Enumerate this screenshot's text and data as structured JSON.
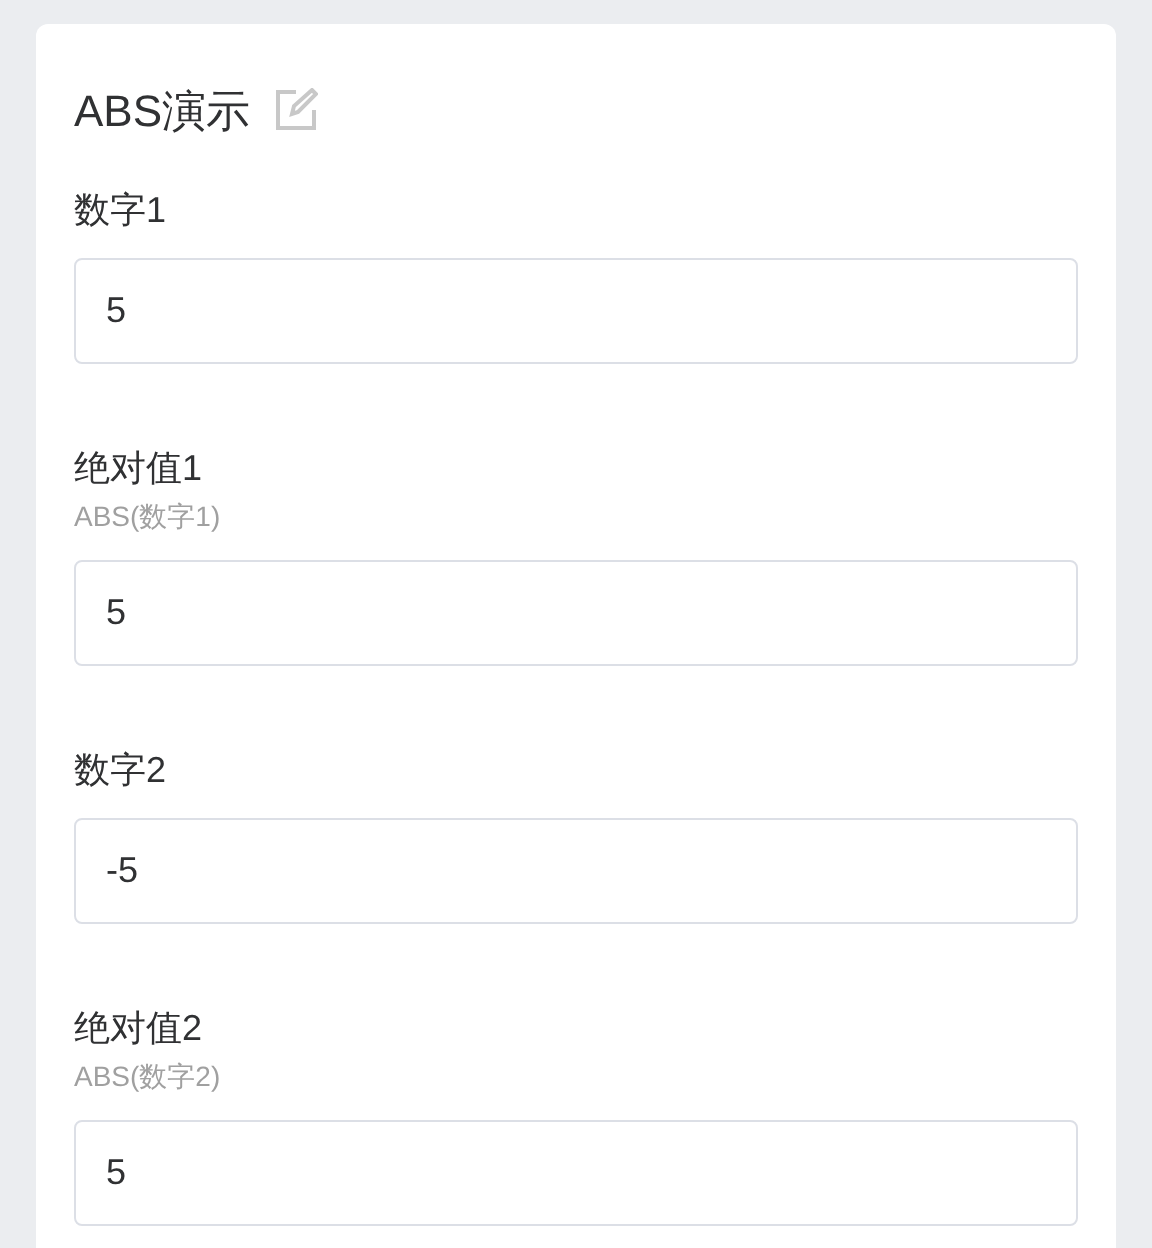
{
  "form": {
    "title": "ABS演示",
    "fields": [
      {
        "label": "数字1",
        "value": "5"
      },
      {
        "label": "绝对值1",
        "hint": "ABS(数字1)",
        "value": "5"
      },
      {
        "label": "数字2",
        "value": "-5"
      },
      {
        "label": "绝对值2",
        "hint": "ABS(数字2)",
        "value": "5"
      }
    ]
  }
}
